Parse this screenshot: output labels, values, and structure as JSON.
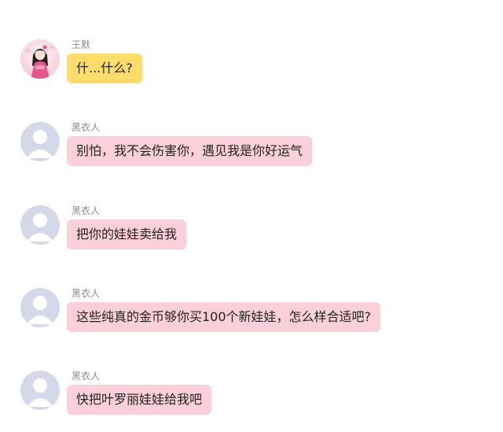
{
  "colors": {
    "self_bubble": "#ffdc6b",
    "other_bubble": "#fcd0da",
    "name_text": "#8a8a8a",
    "message_text": "#222222"
  },
  "messages": [
    {
      "sender": "王默",
      "text": "什...什么?",
      "avatar": "girl-avatar-icon",
      "bubble_color": "yellow"
    },
    {
      "sender": "黑衣人",
      "text": "别怕，我不会伤害你，遇见我是你好运气",
      "avatar": "default-user-avatar-icon",
      "bubble_color": "pink"
    },
    {
      "sender": "黑衣人",
      "text": "把你的娃娃卖给我",
      "avatar": "default-user-avatar-icon",
      "bubble_color": "pink"
    },
    {
      "sender": "黑衣人",
      "text": "这些纯真的金币够你买100个新娃娃，怎么样合适吧?",
      "avatar": "default-user-avatar-icon",
      "bubble_color": "pink"
    },
    {
      "sender": "黑衣人",
      "text": "快把叶罗丽娃娃给我吧",
      "avatar": "default-user-avatar-icon",
      "bubble_color": "pink"
    }
  ]
}
